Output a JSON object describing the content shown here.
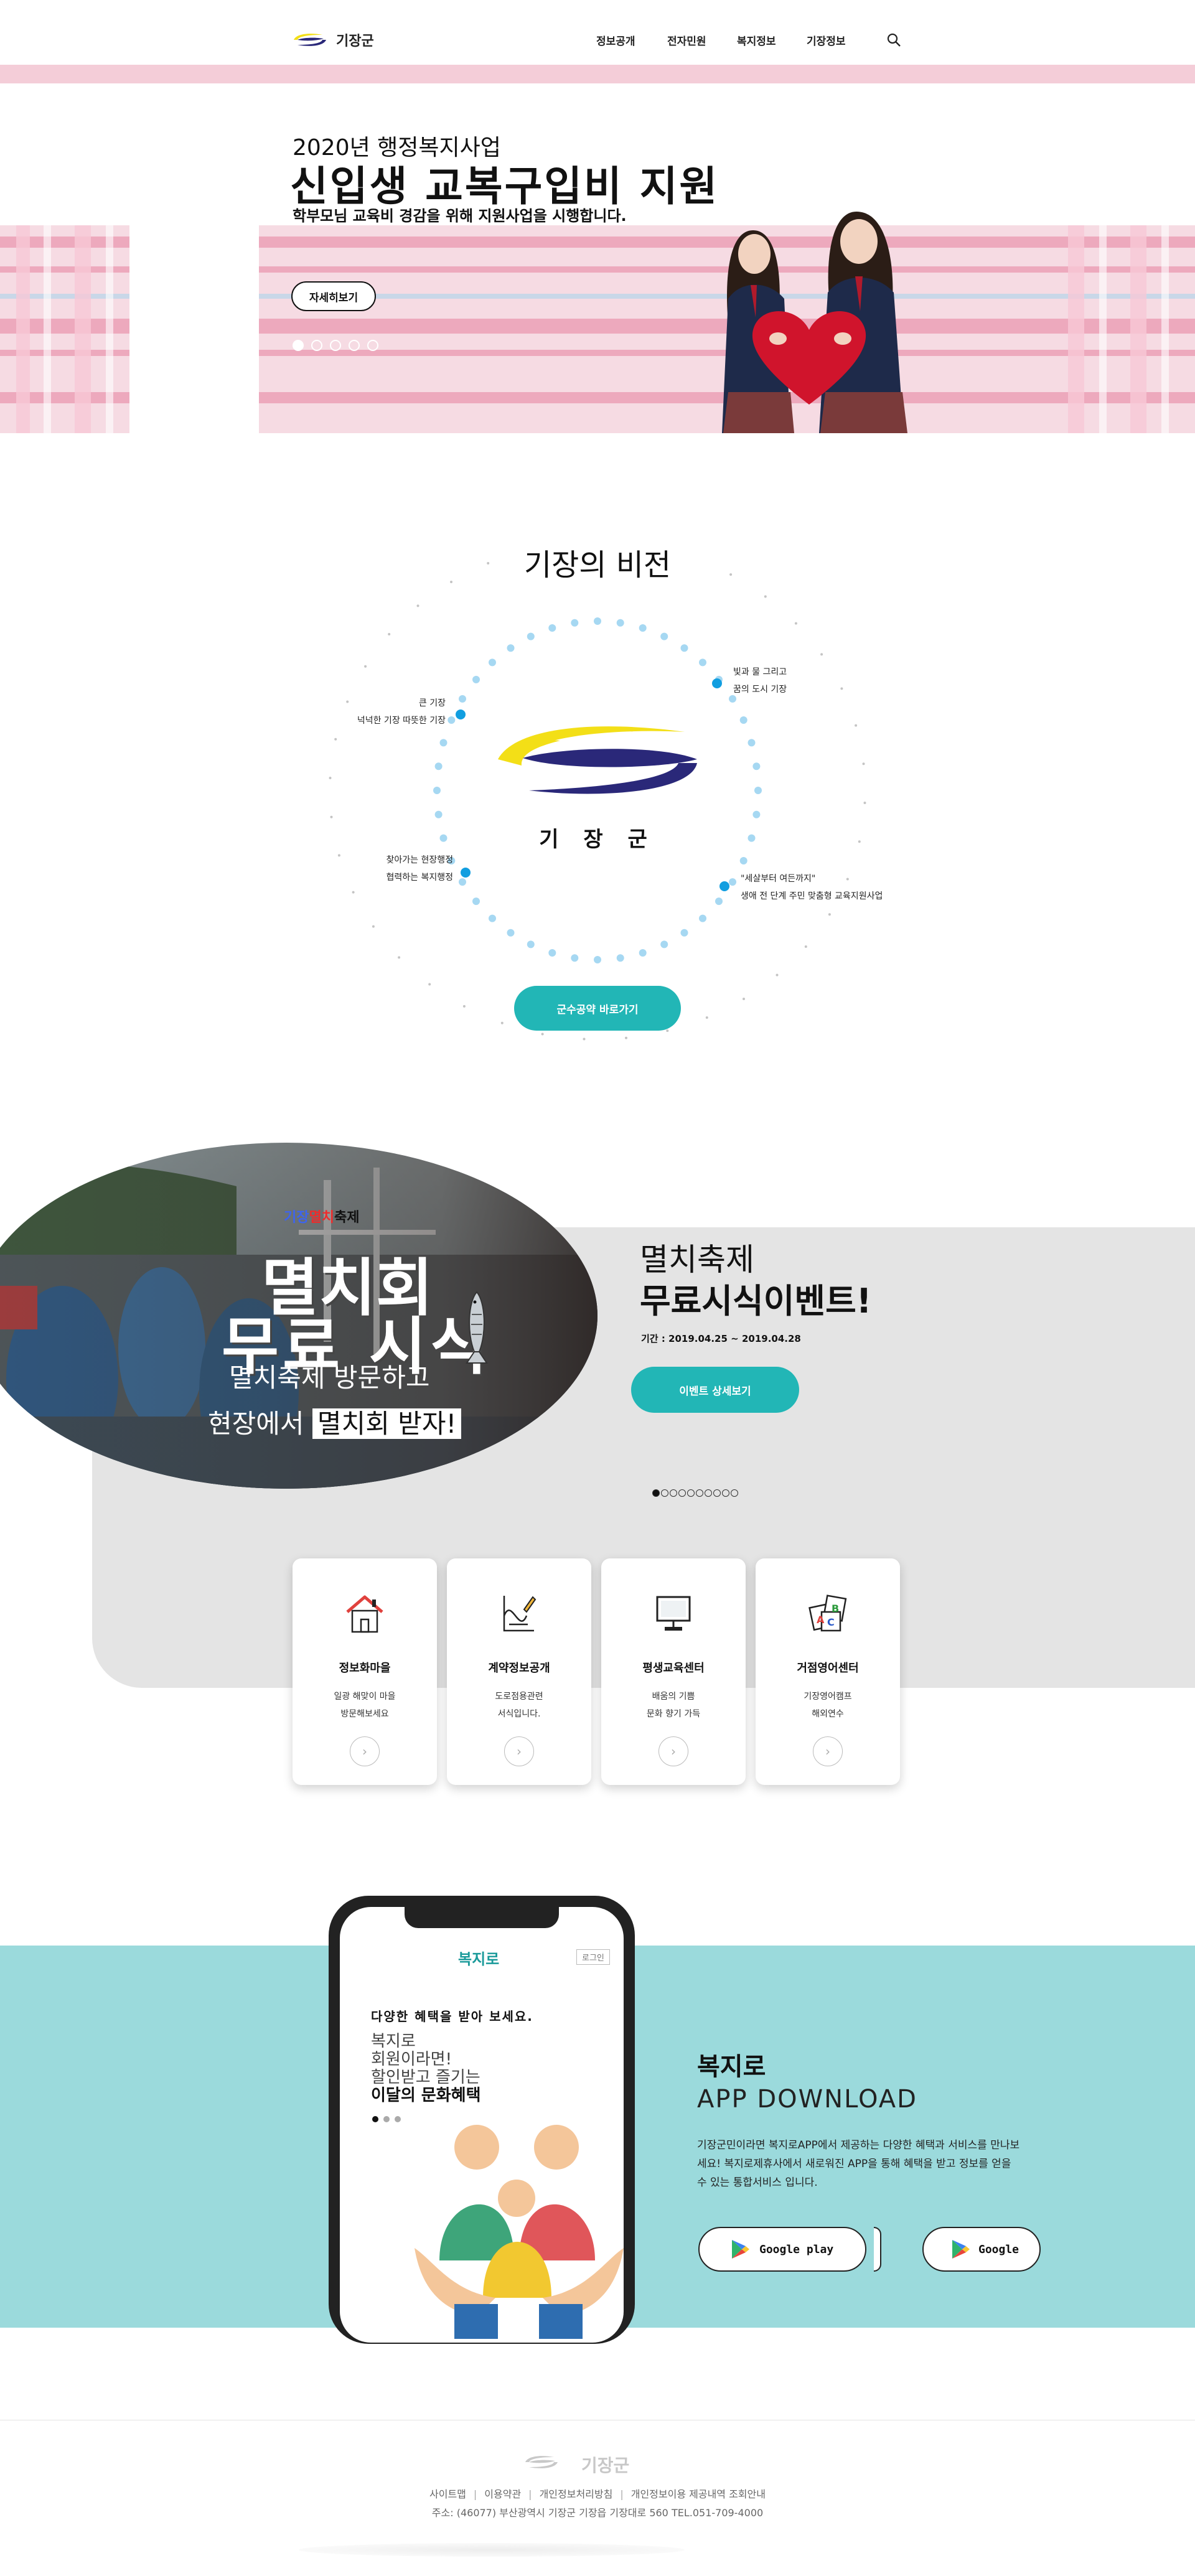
{
  "header": {
    "logo_text": "기장군",
    "nav": [
      "정보공개",
      "전자민원",
      "복지정보",
      "기장정보"
    ]
  },
  "hero": {
    "eyebrow": "2020년 행정복지사업",
    "title": "신입생 교복구입비 지원",
    "subtitle": "학부모님 교육비 경감을 위해 지원사업을 시행합니다.",
    "button_label": "자세히보기",
    "slide_count": 5,
    "active_slide": 1
  },
  "vision": {
    "title": "기장의 비전",
    "logo_text": "기 장 군",
    "labels": [
      {
        "line1": "큰 기장",
        "line2": "넉넉한 기장 따뜻한 기장"
      },
      {
        "line1": "빛과 물 그리고",
        "line2": "꿈의 도시 기장"
      },
      {
        "line1": "찾아가는 현장행정",
        "line2": "협력하는 복지행정"
      },
      {
        "line1": "\"세살부터 여든까지\"",
        "line2": "생애 전 단계 주민 맞춤형 교육지원사업"
      }
    ],
    "button_label": "군수공약 바로가기"
  },
  "festival": {
    "brand_a": "기장",
    "brand_b": "멸치",
    "brand_c": "축제",
    "big_line1": "멸치회",
    "big_line2": "무료 시식",
    "line3": "멸치축제 방문하고",
    "line4_prefix": "현장에서",
    "line4_box": "멸치회 받자!",
    "right_title1": "멸치축제",
    "right_title2": "무료시식이벤트!",
    "date": "기간 : 2019.04.25 ~ 2019.04.28",
    "button_label": "이벤트 상세보기",
    "slide_count": 10,
    "active_slide": 1
  },
  "cards": [
    {
      "title": "정보화마을",
      "desc1": "일광 해맞이 마을",
      "desc2": "방문해보세요",
      "icon": "house-icon"
    },
    {
      "title": "계약정보공개",
      "desc1": "도로점용관련",
      "desc2": "서식입니다.",
      "icon": "contract-icon"
    },
    {
      "title": "평생교육센터",
      "desc1": "배움의 기쁨",
      "desc2": "문화 향기 가득",
      "icon": "monitor-icon"
    },
    {
      "title": "거점영어센터",
      "desc1": "기장영어캠프",
      "desc2": "해외연수",
      "icon": "abc-cards-icon"
    }
  ],
  "app": {
    "phone": {
      "brand": "복지로",
      "login": "로그인",
      "headline": "다양한 혜택을 받아 보세요.",
      "line1": "복지로",
      "line2": "회원이라면!",
      "line3": "할인받고 즐기는",
      "line4": "이달의 문화혜택"
    },
    "title1": "복지로",
    "title2": "APP DOWNLOAD",
    "desc": "기장군민이라면 복지로APP에서 제공하는 다양한 혜택과 서비스를 만나보세요! 복지로제휴사에서 새로워진 APP을 통해 혜택을 받고 정보를 얻을 수 있는 통합서비스 입니다.",
    "store1": "Google play",
    "store2": "Google"
  },
  "footer": {
    "logo_text": "기장군",
    "links": [
      "사이트맵",
      "이용약관",
      "개인정보처리방침",
      "개인정보이용 제공내역 조회안내"
    ],
    "address": "주소: (46077) 부산광역시 기장군 기장읍 기장대로 560 TEL.051-709-4000"
  },
  "colors": {
    "accent_teal": "#22b6b6",
    "app_band": "#9bdadc",
    "pink_strip": "#f4cdd8",
    "gray_panel": "#e4e4e4",
    "logo_yellow": "#f3df17",
    "logo_navy": "#2a2879"
  }
}
